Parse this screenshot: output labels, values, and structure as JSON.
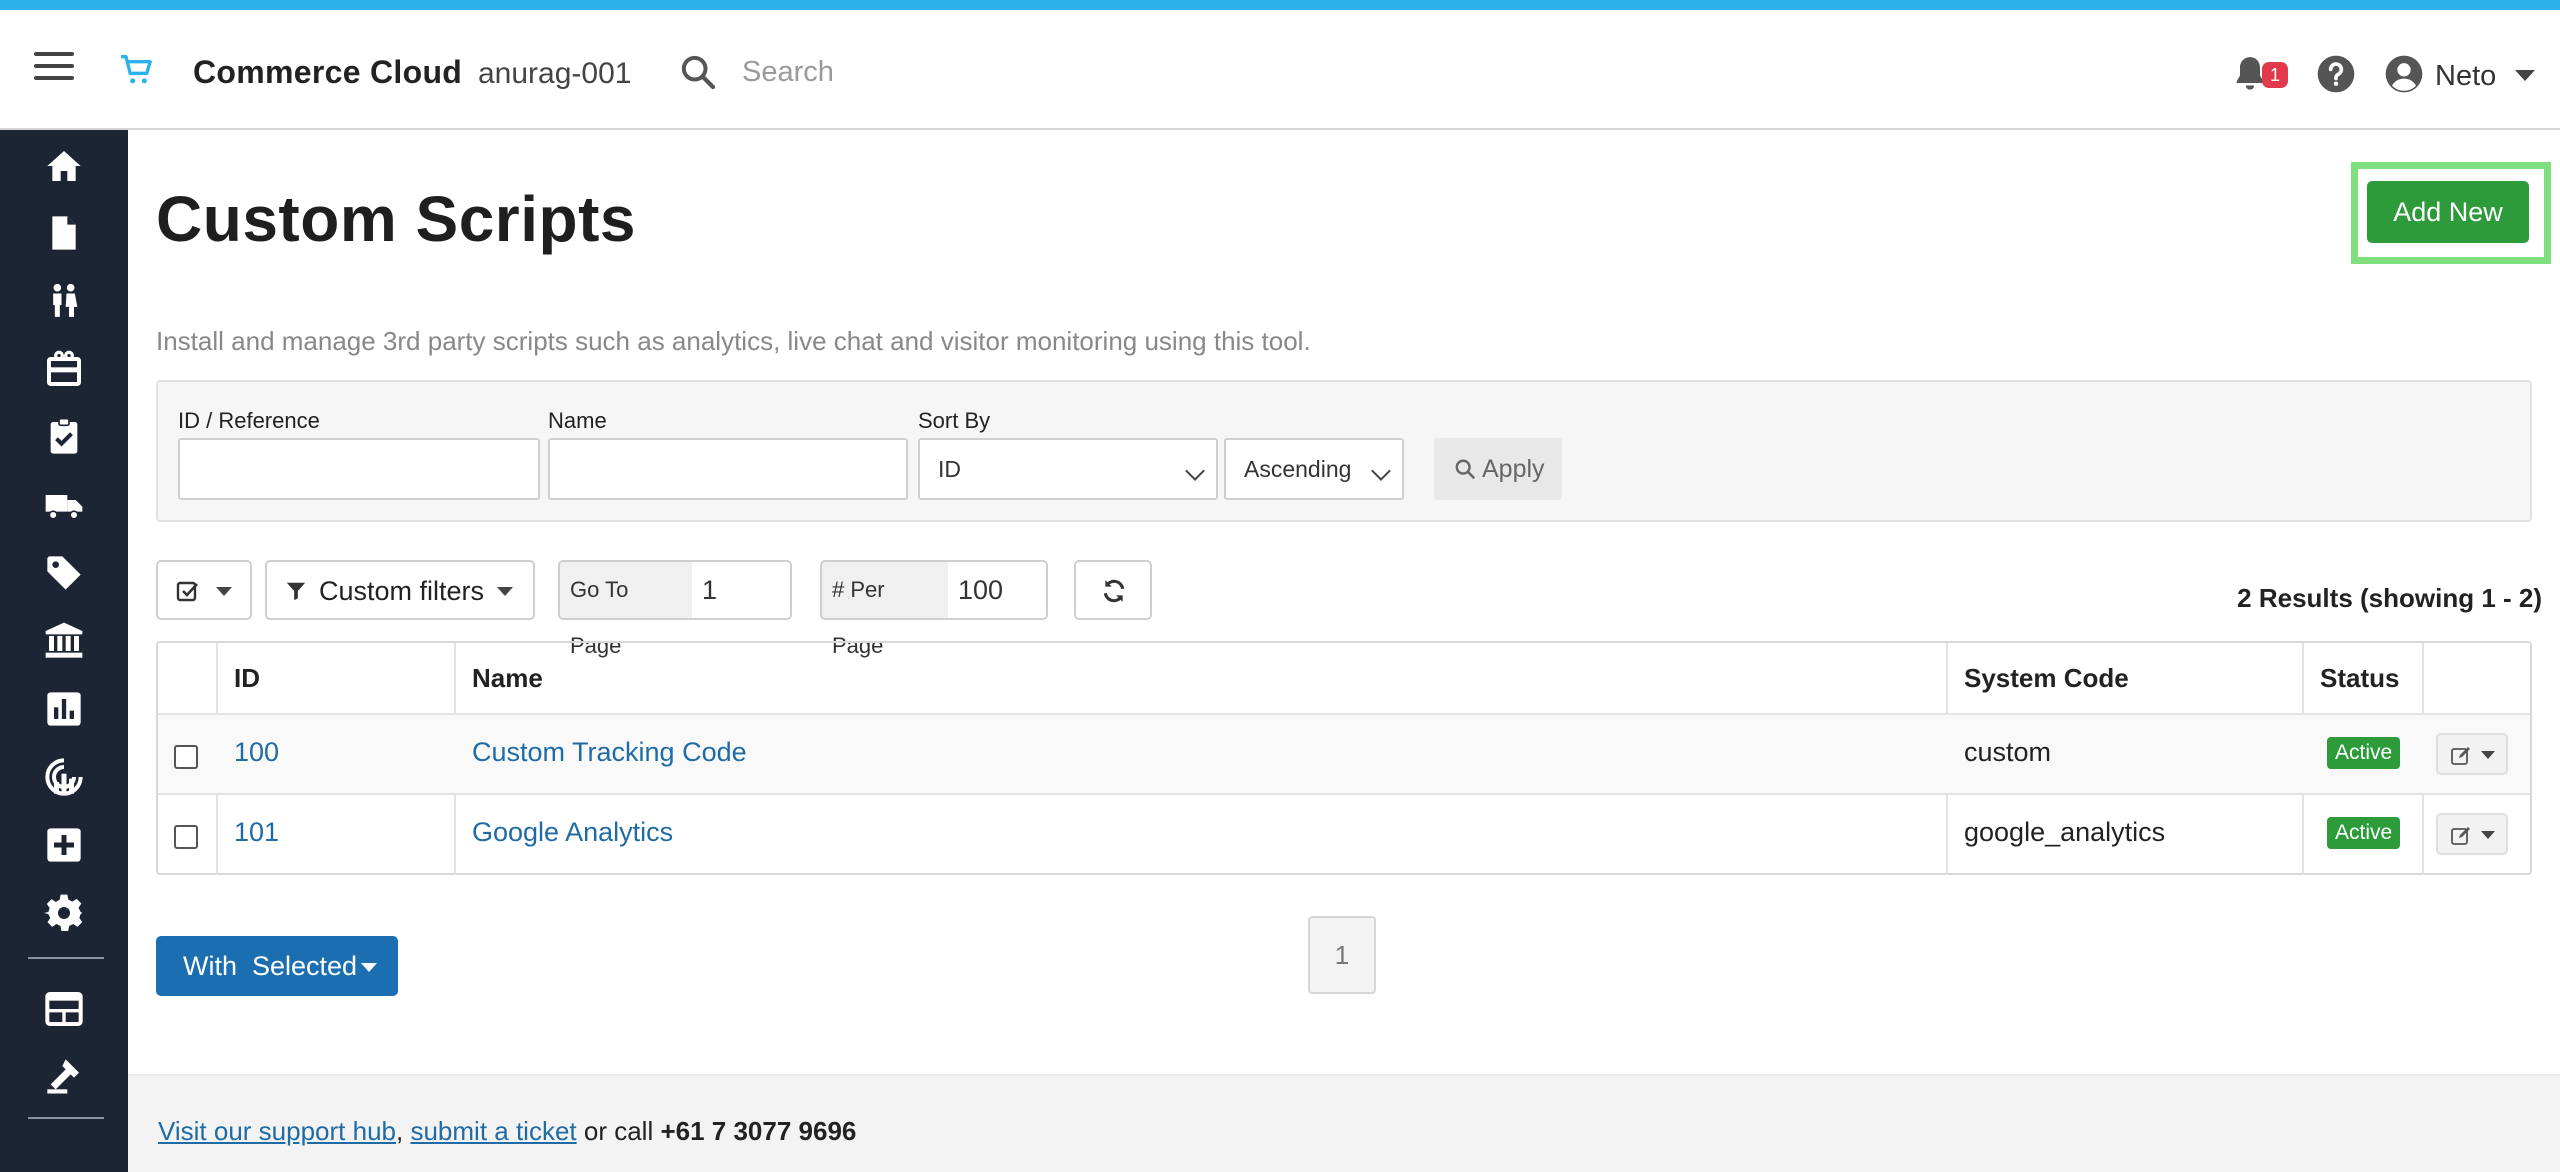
{
  "header": {
    "brand": "Commerce Cloud",
    "store": "anurag-001",
    "search_placeholder": "Search",
    "notification_count": "1",
    "user": "Neto"
  },
  "sidebar": {
    "items": [
      "home-icon",
      "file-icon",
      "customers-icon",
      "marketing-icon",
      "tasks-icon",
      "shipping-icon",
      "price-tag-icon",
      "bank-icon",
      "reports-icon",
      "analytics-icon",
      "add-icon",
      "settings-icon",
      "layout-icon",
      "tools-icon"
    ]
  },
  "page": {
    "title": "Custom Scripts",
    "add_new": "Add New",
    "description": "Install and manage 3rd party scripts such as analytics, live chat and visitor monitoring using this tool."
  },
  "filters": {
    "id_label": "ID / Reference",
    "id_value": "",
    "name_label": "Name",
    "name_value": "",
    "sort_label": "Sort By",
    "sort_value": "ID",
    "order_value": "Ascending",
    "apply": "Apply"
  },
  "toolbar": {
    "custom_filters": "Custom filters",
    "goto_label": "Go To Page",
    "goto_value": "1",
    "perpage_label": "# Per Page",
    "perpage_value": "100",
    "results": "2 Results (showing 1 - 2)"
  },
  "table": {
    "headers": {
      "id": "ID",
      "name": "Name",
      "code": "System Code",
      "status": "Status"
    },
    "rows": [
      {
        "id": "100",
        "name": "Custom Tracking Code",
        "code": "custom",
        "status": "Active"
      },
      {
        "id": "101",
        "name": "Google Analytics",
        "code": "google_analytics",
        "status": "Active"
      }
    ]
  },
  "pagination": {
    "current": "1"
  },
  "bulk": {
    "with_selected": "With  Selected"
  },
  "footer": {
    "support_link": "Visit our support hub",
    "comma": ",",
    "ticket_link": "submit a ticket",
    "call_text": " or call ",
    "phone": "+61 7 3077 9696"
  },
  "colors": {
    "accent": "#2bb2ea",
    "primary": "#1b6fb0",
    "success": "#2e9b3b",
    "sidebar": "#1d2433",
    "highlight": "#7fdf7f"
  }
}
